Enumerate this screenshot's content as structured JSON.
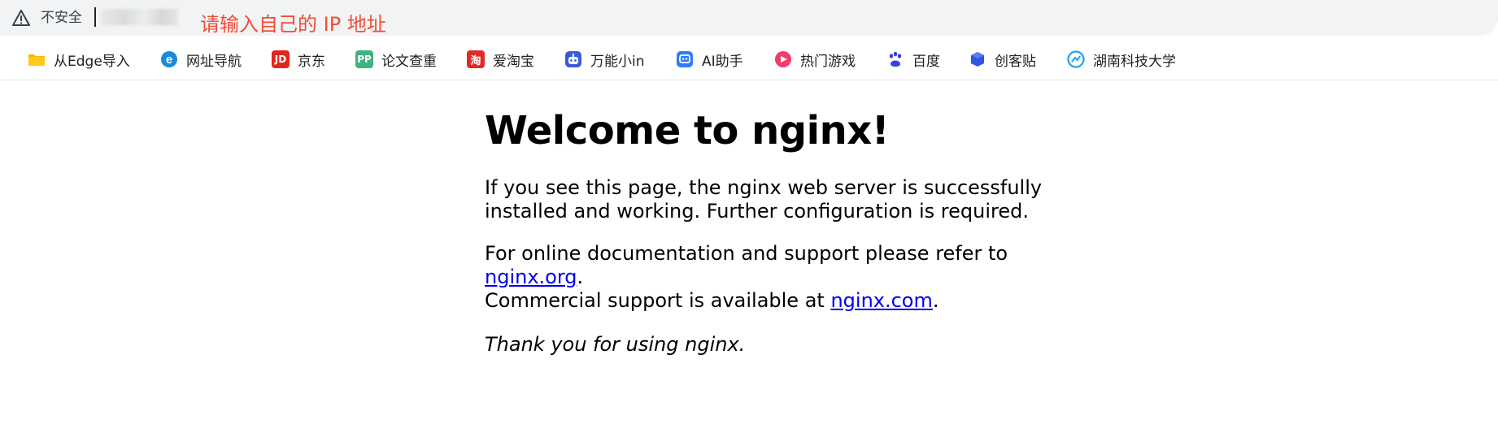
{
  "address_bar": {
    "security_label": "不安全",
    "hint": "请输入自己的 IP 地址"
  },
  "bookmarks": {
    "items": [
      {
        "label": "从Edge导入",
        "icon": "folder-icon",
        "color": "#f5b800"
      },
      {
        "label": "网址导航",
        "icon": "ie-icon",
        "color": "#1a8bd8"
      },
      {
        "label": "京东",
        "icon": "jd-icon",
        "color": "#e1251b",
        "glyph": "JD"
      },
      {
        "label": "论文查重",
        "icon": "pp-icon",
        "color": "#3fb27f",
        "glyph": "PP"
      },
      {
        "label": "爱淘宝",
        "icon": "taobao-icon",
        "color": "#e02a2a",
        "glyph": "淘"
      },
      {
        "label": "万能小in",
        "icon": "robot-icon",
        "color": "#3a5bd6"
      },
      {
        "label": "AI助手",
        "icon": "ai-chat-icon",
        "color": "#2f7df6"
      },
      {
        "label": "热门游戏",
        "icon": "game-icon",
        "color": "#ef3e68"
      },
      {
        "label": "百度",
        "icon": "baidu-paw-icon",
        "color": "#3245df"
      },
      {
        "label": "创客贴",
        "icon": "chuangketie-icon",
        "color": "#2f56e0"
      },
      {
        "label": "湖南科技大学",
        "icon": "university-icon",
        "color": "#1fa2e8"
      }
    ]
  },
  "page": {
    "title": "Welcome to nginx!",
    "p1": "If you see this page, the nginx web server is successfully installed and working. Further configuration is required.",
    "p2_prefix": "For online documentation and support please refer to ",
    "link_org": "nginx.org",
    "p2_mid": ".",
    "p2_prefix2": "Commercial support is available at ",
    "link_com": "nginx.com",
    "p2_end": ".",
    "p3": "Thank you for using nginx."
  }
}
